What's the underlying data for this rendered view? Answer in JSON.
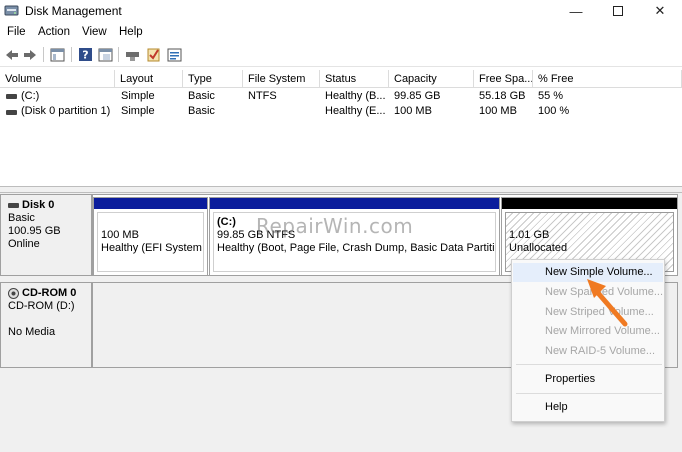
{
  "window": {
    "title": "Disk Management",
    "minimize_glyph": "—",
    "close_glyph": "✕"
  },
  "menu": [
    "File",
    "Action",
    "View",
    "Help"
  ],
  "toolbar_icons": [
    "back-arrow-icon",
    "forward-arrow-icon",
    "show-hide-console-tree-icon",
    "help-icon",
    "properties-icon",
    "connect-icon",
    "check-icon",
    "details-icon"
  ],
  "columns": [
    "Volume",
    "Layout",
    "Type",
    "File System",
    "Status",
    "Capacity",
    "Free Spa...",
    "% Free"
  ],
  "volumes": [
    {
      "volume": "(C:)",
      "layout": "Simple",
      "type": "Basic",
      "fs": "NTFS",
      "status": "Healthy (B...",
      "capacity": "99.85 GB",
      "free": "55.18 GB",
      "pct": "55 %"
    },
    {
      "volume": "(Disk 0 partition 1)",
      "layout": "Simple",
      "type": "Basic",
      "fs": "",
      "status": "Healthy (E...",
      "capacity": "100 MB",
      "free": "100 MB",
      "pct": "100 %"
    }
  ],
  "disk0": {
    "name": "Disk 0",
    "type": "Basic",
    "size": "100.95 GB",
    "state": "Online",
    "p1": {
      "size": "100 MB",
      "status": "Healthy (EFI System P"
    },
    "p2": {
      "label": "(C:)",
      "size": "99.85 GB NTFS",
      "status": "Healthy (Boot, Page File, Crash Dump, Basic Data Partition)"
    },
    "p3": {
      "size": "1.01 GB",
      "status": "Unallocated"
    }
  },
  "cdrom": {
    "name": "CD-ROM 0",
    "drive": "CD-ROM (D:)",
    "media": "No Media"
  },
  "watermark": "RepairWin.com",
  "context_menu": {
    "new_simple": "New Simple Volume...",
    "new_spanned": "New Spanned Volume...",
    "new_striped": "New Striped Volume...",
    "new_mirrored": "New Mirrored Volume...",
    "new_raid5": "New RAID-5 Volume...",
    "properties": "Properties",
    "help": "Help"
  },
  "colors": {
    "primary_partition_bar": "#0b1d9c",
    "unallocated_bar": "#000000",
    "arrow": "#f07a22"
  }
}
